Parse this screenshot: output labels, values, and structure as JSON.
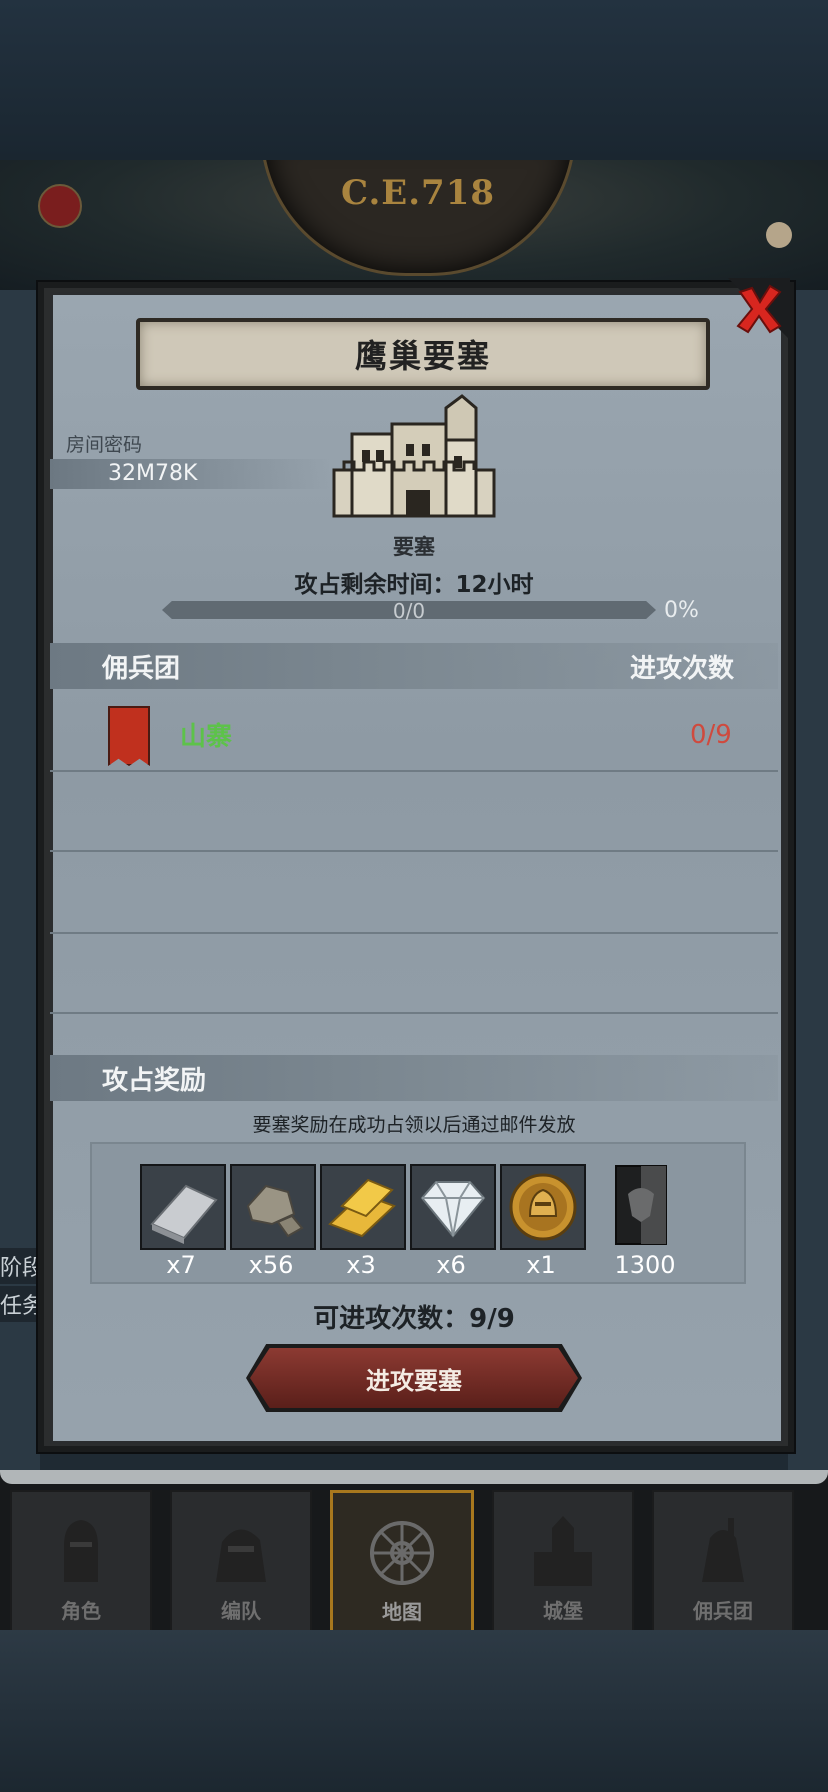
{
  "header": {
    "year": "C.E.718"
  },
  "side_hints": {
    "left_line1": "阶段",
    "left_line2": "任务"
  },
  "dialog": {
    "title": "鹰巢要塞",
    "room_code_label": "房间密码",
    "room_code": "32M78K",
    "building_label": "要塞",
    "timer_text": "攻占剩余时间：12小时",
    "progress": {
      "text": "0/0",
      "percent_text": "0%",
      "fraction": 0
    },
    "columns": {
      "left": "佣兵团",
      "right": "进攻次数"
    },
    "rows": [
      {
        "name": "山寨",
        "count": "0/9",
        "name_color": "#5dc24a",
        "count_color": "#cf4a3e"
      }
    ],
    "rewards_title": "攻占奖励",
    "rewards_note": "要塞奖励在成功占领以后通过邮件发放",
    "rewards": [
      {
        "icon": "iron-ingot-icon",
        "count": "x7"
      },
      {
        "icon": "stone-ore-icon",
        "count": "x56"
      },
      {
        "icon": "gold-bar-icon",
        "count": "x3"
      },
      {
        "icon": "diamond-icon",
        "count": "x6"
      },
      {
        "icon": "knight-medal-icon",
        "count": "x1"
      },
      {
        "icon": "guild-banner-icon",
        "count": "1300"
      }
    ],
    "attempts_text": "可进攻次数：9/9",
    "attack_button": "进攻要塞"
  },
  "nav": {
    "tabs": [
      {
        "label": "角色",
        "icon": "knight-helmet-icon"
      },
      {
        "label": "编队",
        "icon": "formation-icon"
      },
      {
        "label": "地图",
        "icon": "compass-icon",
        "active": true
      },
      {
        "label": "城堡",
        "icon": "castle-icon"
      },
      {
        "label": "佣兵团",
        "icon": "mercenary-icon"
      }
    ]
  },
  "colors": {
    "accent_gold": "#a8781e",
    "close_red": "#d8261f",
    "progress_text": "#c7ccd0"
  }
}
